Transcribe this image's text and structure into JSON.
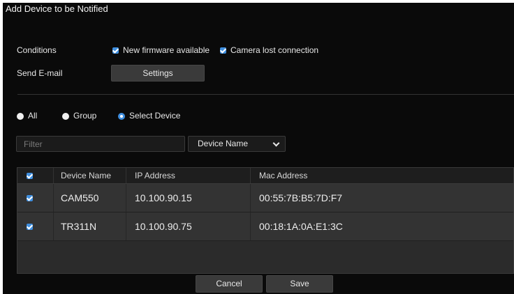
{
  "dialog": {
    "title": "Add Device to be Notified"
  },
  "conditions": {
    "label": "Conditions",
    "new_firmware": {
      "label": "New firmware available",
      "checked": true
    },
    "camera_lost": {
      "label": "Camera lost connection",
      "checked": true
    }
  },
  "email": {
    "label": "Send E-mail",
    "settings_button": "Settings"
  },
  "scope": {
    "options": [
      {
        "label": "All",
        "selected": false
      },
      {
        "label": "Group",
        "selected": false
      },
      {
        "label": "Select Device",
        "selected": true
      }
    ]
  },
  "filter": {
    "placeholder": "Filter",
    "value": ""
  },
  "sort_select": {
    "value": "Device Name"
  },
  "table": {
    "headers": [
      "Device Name",
      "IP Address",
      "Mac Address"
    ],
    "header_checkbox_checked": true,
    "rows": [
      {
        "checked": true,
        "device_name": "CAM550",
        "ip": "10.100.90.15",
        "mac": "00:55:7B:B5:7D:F7"
      },
      {
        "checked": true,
        "device_name": "TR311N",
        "ip": "10.100.90.75",
        "mac": "00:18:1A:0A:E1:3C"
      }
    ]
  },
  "footer": {
    "cancel": "Cancel",
    "save": "Save"
  },
  "colors": {
    "background": "#0a0a0a",
    "accent": "#3f8fe0",
    "button": "#3a3a3a"
  }
}
